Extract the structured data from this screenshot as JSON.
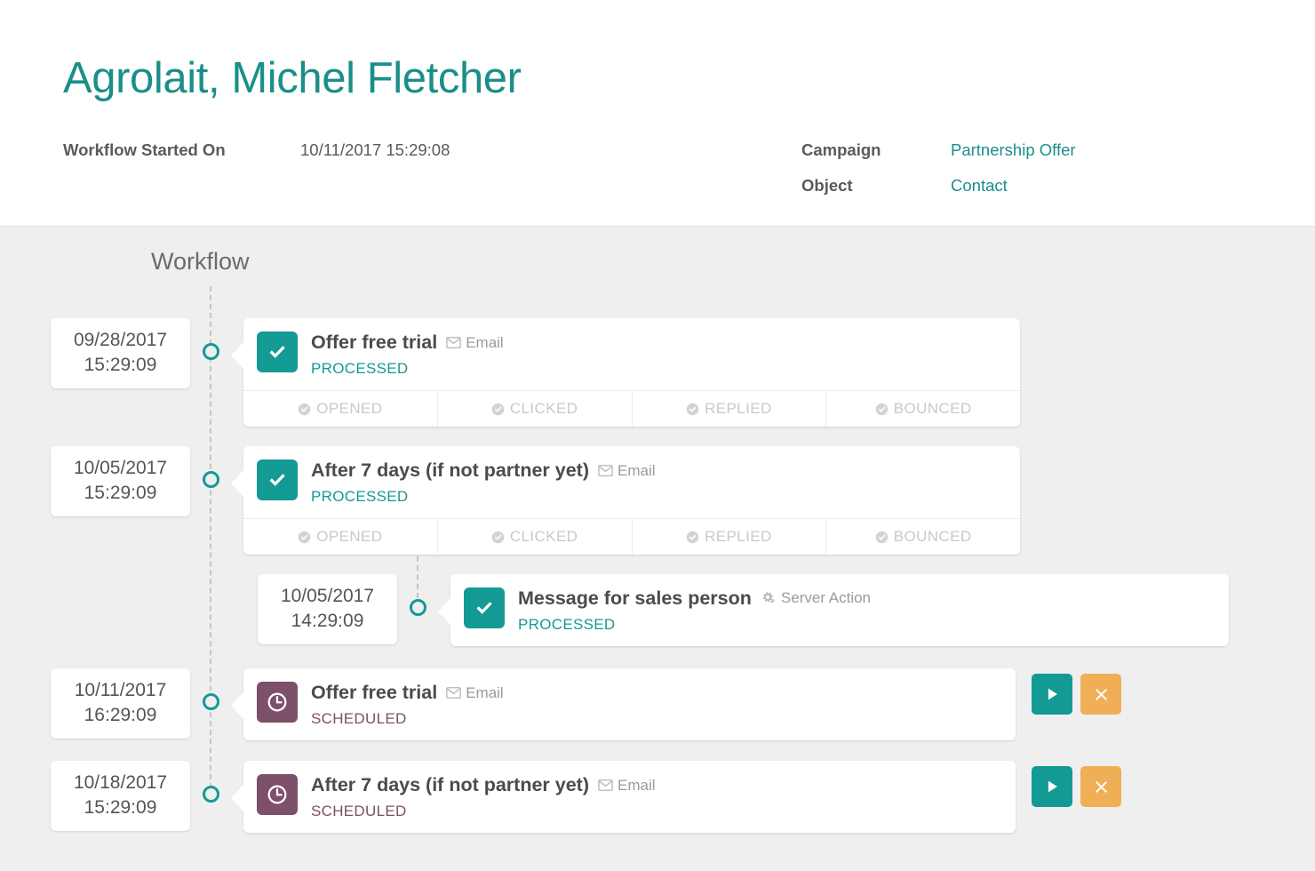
{
  "header": {
    "title": "Agrolait, Michel Fletcher",
    "fields_left": [
      {
        "label": "Workflow Started On",
        "value": "10/11/2017 15:29:08",
        "link": false
      }
    ],
    "fields_right": [
      {
        "label": "Campaign",
        "value": "Partnership Offer",
        "link": true
      },
      {
        "label": "Object",
        "value": "Contact",
        "link": true
      }
    ]
  },
  "timeline": {
    "section_label": "Workflow",
    "status_labels": [
      "OPENED",
      "CLICKED",
      "REPLIED",
      "BOUNCED"
    ],
    "items": [
      {
        "date": "09/28/2017",
        "time": "15:29:09",
        "title": "Offer free trial",
        "kind": "Email",
        "kind_icon": "envelope-icon",
        "status": "PROCESSED",
        "state": "done",
        "badge_icon": "check-icon",
        "has_status_strip": true,
        "has_actions": false,
        "nested": false
      },
      {
        "date": "10/05/2017",
        "time": "15:29:09",
        "title": "After 7 days (if not partner yet)",
        "kind": "Email",
        "kind_icon": "envelope-icon",
        "status": "PROCESSED",
        "state": "done",
        "badge_icon": "check-icon",
        "has_status_strip": true,
        "has_actions": false,
        "nested": false
      },
      {
        "date": "10/05/2017",
        "time": "14:29:09",
        "title": "Message for sales person",
        "kind": "Server Action",
        "kind_icon": "gears-icon",
        "status": "PROCESSED",
        "state": "done",
        "badge_icon": "check-icon",
        "has_status_strip": false,
        "has_actions": false,
        "nested": true
      },
      {
        "date": "10/11/2017",
        "time": "16:29:09",
        "title": "Offer free trial",
        "kind": "Email",
        "kind_icon": "envelope-icon",
        "status": "SCHEDULED",
        "state": "scheduled",
        "badge_icon": "clock-icon",
        "has_status_strip": false,
        "has_actions": true,
        "nested": false
      },
      {
        "date": "10/18/2017",
        "time": "15:29:09",
        "title": "After 7 days (if not partner yet)",
        "kind": "Email",
        "kind_icon": "envelope-icon",
        "status": "SCHEDULED",
        "state": "scheduled",
        "badge_icon": "clock-icon",
        "has_status_strip": false,
        "has_actions": true,
        "nested": false
      }
    ],
    "actions": {
      "run_label": "Run now",
      "cancel_label": "Cancel"
    }
  },
  "colors": {
    "teal": "#139a95",
    "purple": "#7d5069",
    "orange": "#f0ae56",
    "page_bg": "#efefef"
  }
}
